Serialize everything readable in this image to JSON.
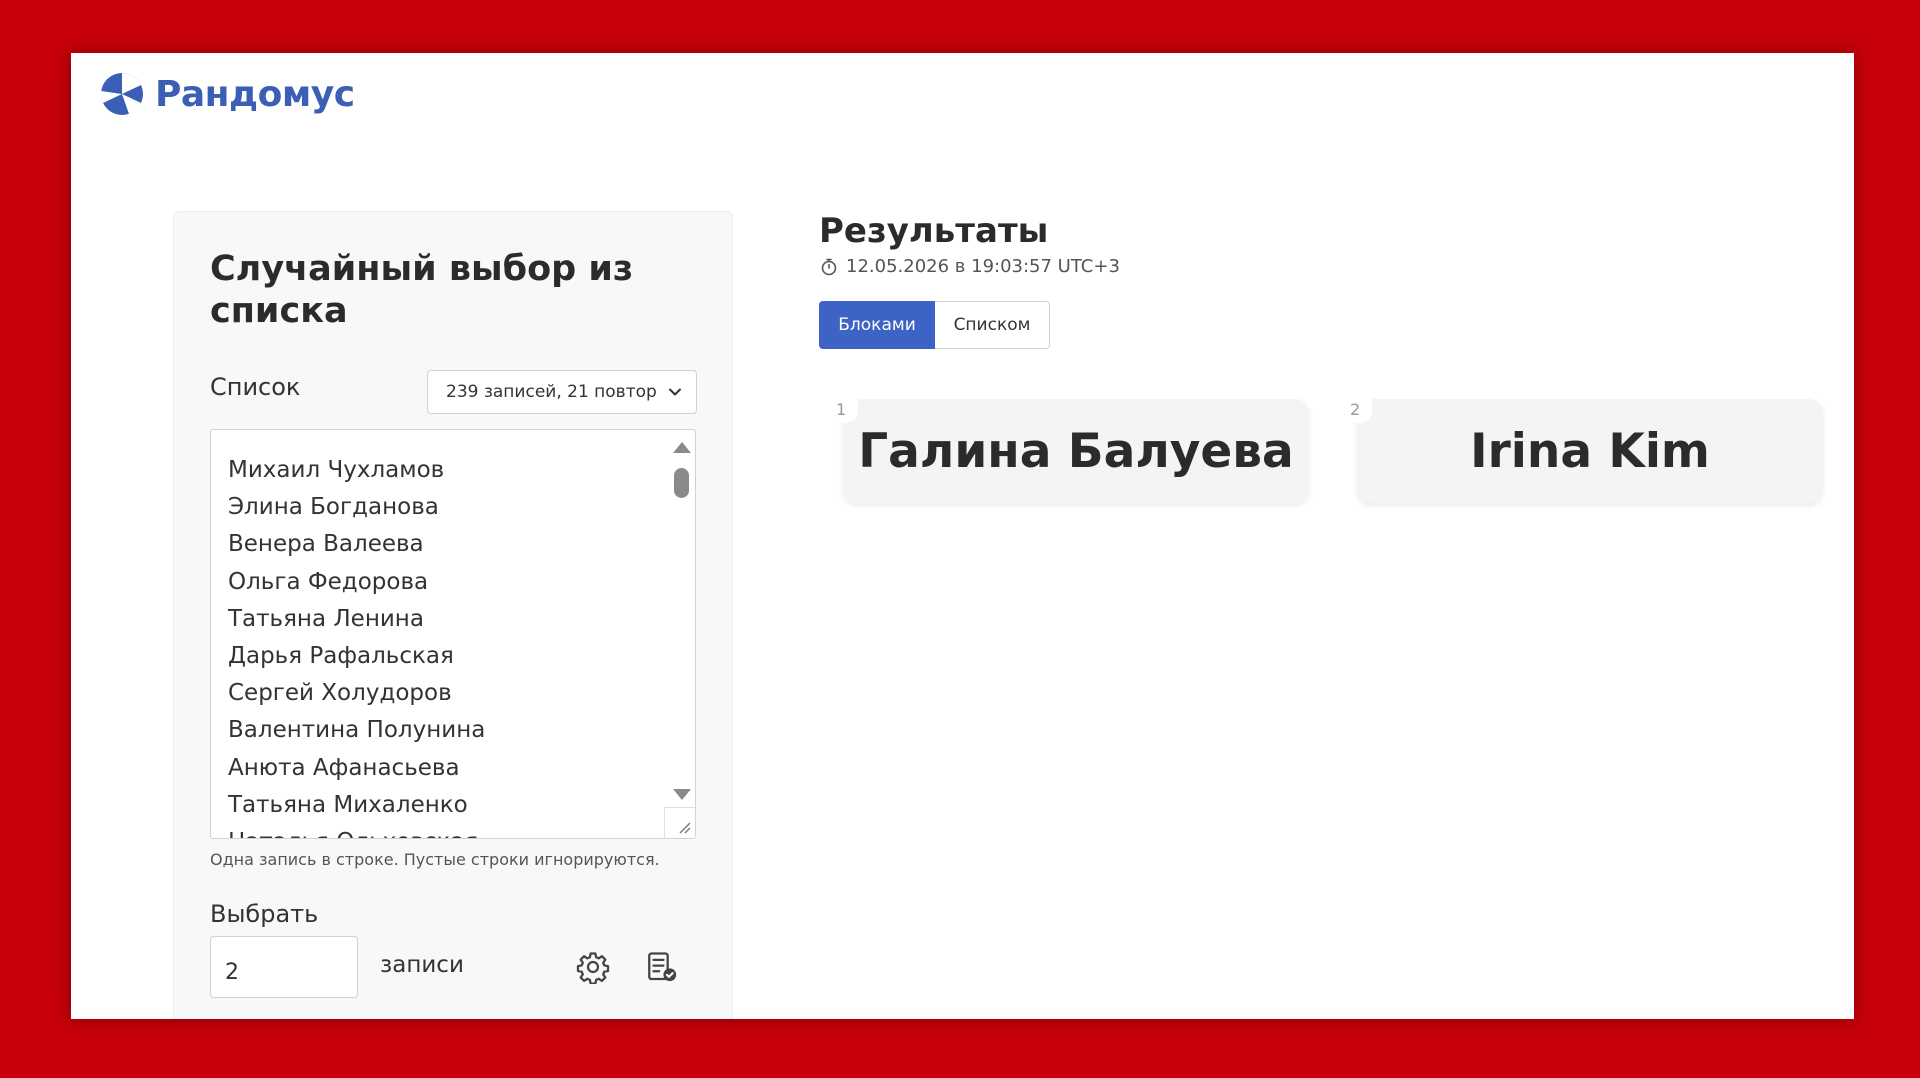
{
  "app": {
    "name": "Рандомус",
    "brand_color": "#3a5fb5",
    "accent_color": "#3d63c6",
    "frame_background": "#c8000b"
  },
  "form": {
    "title": "Случайный выбор из списка",
    "list_label": "Список",
    "list_select_value": "239 записей, 21 повтор",
    "names": [
      "Михаил Чухламов",
      "Элина Богданова",
      "Венера Валеева",
      "Ольга Федорова",
      "Татьяна Ленина",
      "Дарья Рафальская",
      "Сергей Холудоров",
      "Валентина Полунина",
      "Анюта Афанасьева",
      "Татьяна Михаленко",
      "Наталья Ольховская"
    ],
    "hint": "Одна запись в строке. Пустые строки игнорируются.",
    "choose_label": "Выбрать",
    "count_value": "2",
    "records_label": "записи"
  },
  "results": {
    "title": "Результаты",
    "timestamp": "12.05.2026 в 19:03:57 UTC+3",
    "view_blocks": "Блоками",
    "view_list": "Списком",
    "items": [
      {
        "num": "1",
        "name": "Галина Балуева"
      },
      {
        "num": "2",
        "name": "Irina Kim"
      }
    ]
  },
  "icons": {
    "logo": "randomus-logo-icon",
    "stopwatch": "stopwatch-icon",
    "chevron": "chevron-down-icon",
    "settings": "gear-icon",
    "list_check": "list-check-icon"
  }
}
